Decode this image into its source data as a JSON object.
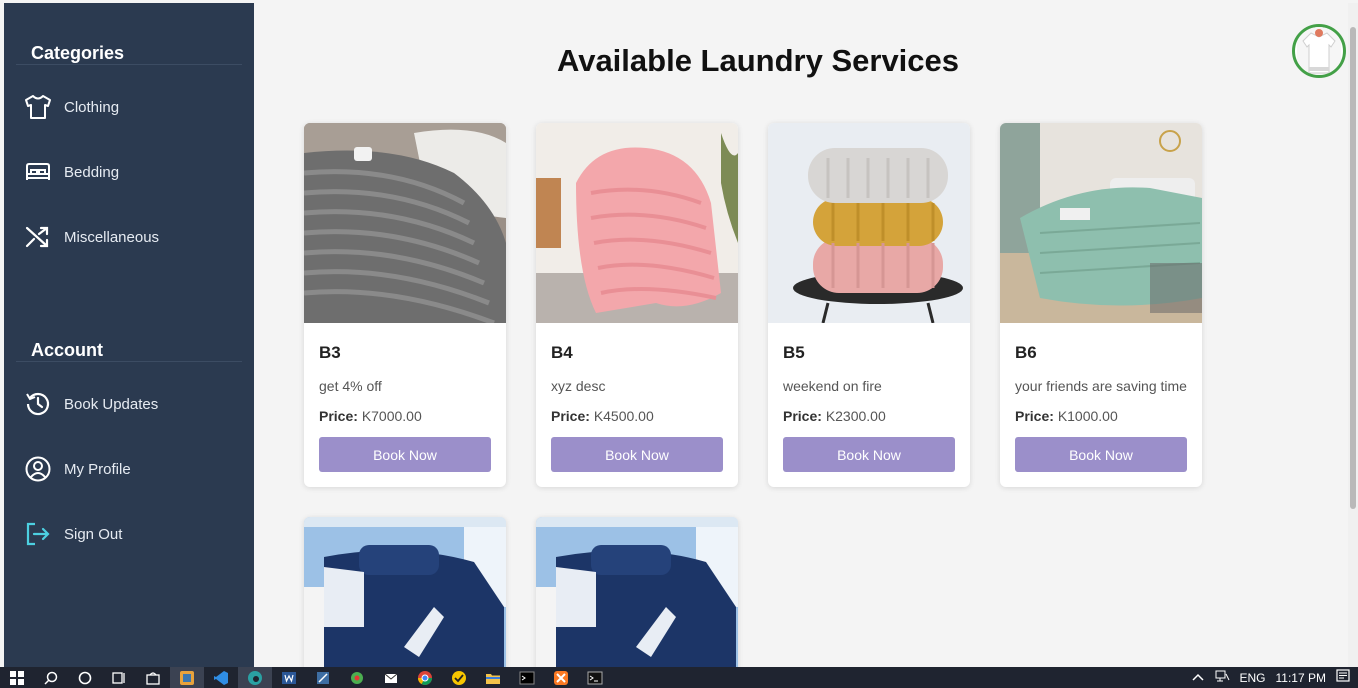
{
  "sidebar": {
    "categories_title": "Categories",
    "categories": [
      {
        "label": "Clothing",
        "icon": "tshirt-icon"
      },
      {
        "label": "Bedding",
        "icon": "bed-icon"
      },
      {
        "label": "Miscellaneous",
        "icon": "shuffle-icon"
      }
    ],
    "account_title": "Account",
    "account": [
      {
        "label": "Book Updates",
        "icon": "history-icon"
      },
      {
        "label": "My Profile",
        "icon": "user-circle-icon"
      },
      {
        "label": "Sign Out",
        "icon": "sign-out-icon"
      }
    ]
  },
  "main": {
    "title": "Available Laundry Services",
    "avatar_icon": "user-avatar-icon",
    "price_label": "Price:",
    "book_label": "Book Now",
    "services": [
      {
        "name": "B3",
        "desc": "get 4% off",
        "price": "K7000.00",
        "image": "grey-striped-blanket-photo"
      },
      {
        "name": "B4",
        "desc": "xyz desc",
        "price": "K4500.00",
        "image": "pink-fluffy-throw-photo"
      },
      {
        "name": "B5",
        "desc": "weekend on fire",
        "price": "K2300.00",
        "image": "folded-knit-blankets-photo"
      },
      {
        "name": "B6",
        "desc": "your friends are saving time",
        "price": "K1000.00",
        "image": "green-bedspread-photo"
      },
      {
        "name": "",
        "desc": "",
        "price": "",
        "image": "navy-bedding-set-photo"
      },
      {
        "name": "",
        "desc": "",
        "price": "",
        "image": "navy-bedding-set-photo"
      }
    ]
  },
  "taskbar": {
    "lang": "ENG",
    "time": "11:17 PM"
  },
  "colors": {
    "sidebar_bg": "#2b3a50",
    "button_bg": "#9b8fca",
    "avatar_border": "#43a047",
    "signout_accent": "#4dd0e1"
  }
}
